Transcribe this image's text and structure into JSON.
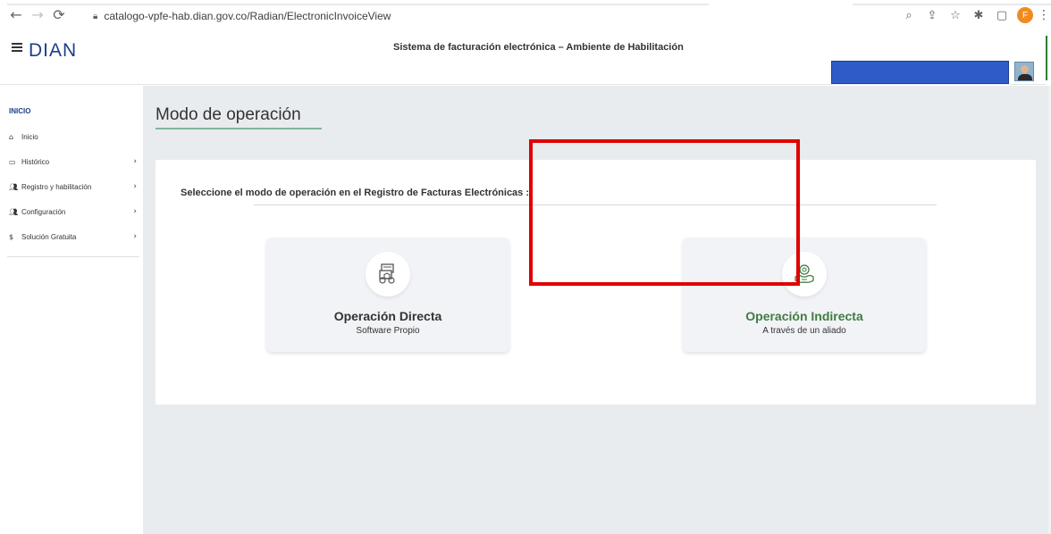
{
  "browser": {
    "url": "catalogo-vpfe-hab.dian.gov.co/Radian/ElectronicInvoiceView",
    "profile_initial": "F",
    "icons": [
      "back-icon",
      "forward-icon",
      "reload-icon",
      "lock-icon",
      "zoom-icon",
      "share-icon",
      "star-icon",
      "extensions-icon",
      "sidepanel-icon",
      "kebab-icon"
    ]
  },
  "header": {
    "logo": "DIAN",
    "title": "Sistema de facturación electrónica – Ambiente de Habilitación"
  },
  "sidebar": {
    "section": "INICIO",
    "items": [
      {
        "label": "Inicio",
        "icon": "home-icon",
        "chevron": ""
      },
      {
        "label": "Histórico",
        "icon": "history-icon",
        "chevron": "›"
      },
      {
        "label": "Registro y habilitación",
        "icon": "users-icon",
        "chevron": "›"
      },
      {
        "label": "Configuración",
        "icon": "users-icon",
        "chevron": "›"
      },
      {
        "label": "Solución Gratuita",
        "icon": "dollar-icon",
        "chevron": "›"
      }
    ]
  },
  "main": {
    "page_title": "Modo de operación",
    "heading": "Seleccione el modo de operación en el Registro de Facturas Electrónicas :",
    "options": [
      {
        "title": "Operación Directa",
        "subtitle": "Software Propio",
        "icon": "software-icon"
      },
      {
        "title": "Operación Indirecta",
        "subtitle": "A través de un aliado",
        "icon": "handshake-icon"
      }
    ]
  },
  "colors": {
    "accent_green": "#3f7d3f",
    "highlight_red": "#e00000",
    "brand_blue": "#1e3f8a"
  }
}
